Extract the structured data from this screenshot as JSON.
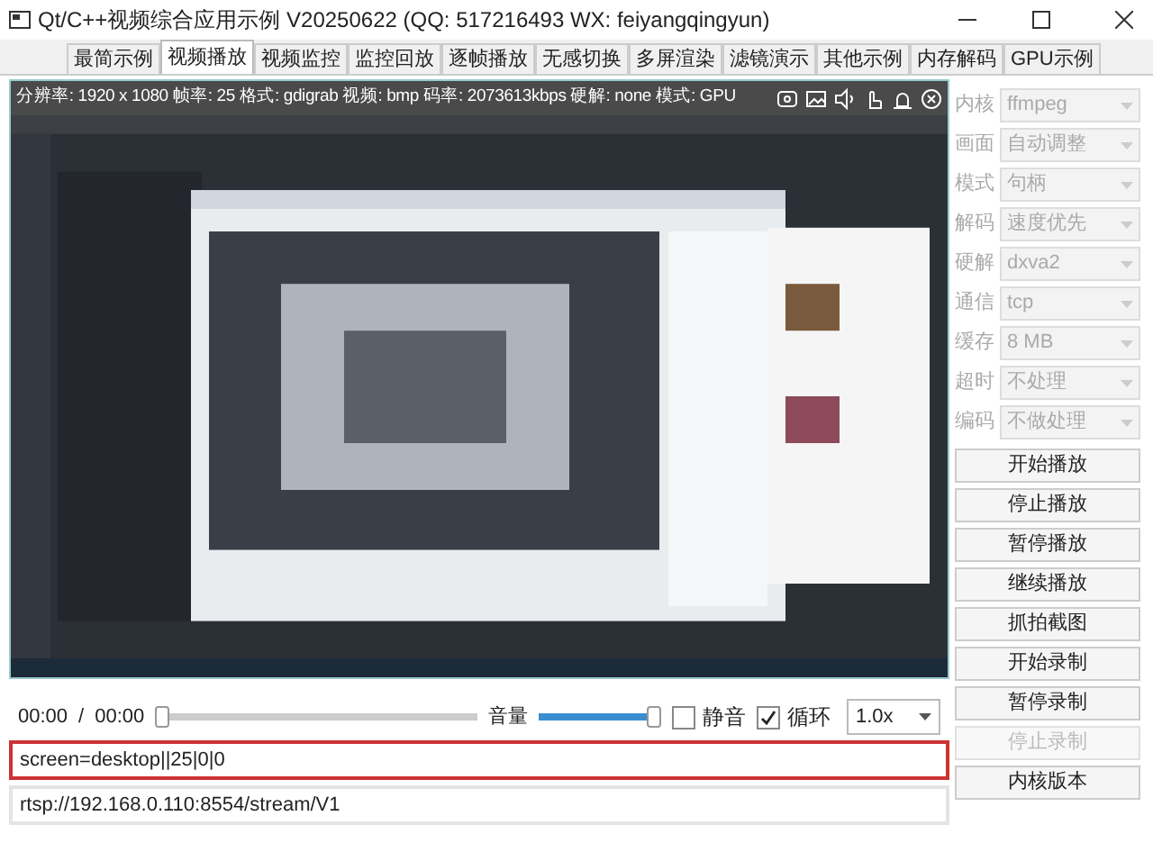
{
  "window": {
    "title": "Qt/C++视频综合应用示例 V20250622 (QQ: 517216493 WX: feiyangqingyun)"
  },
  "tabs": [
    {
      "label": "最简示例",
      "selected": false
    },
    {
      "label": "视频播放",
      "selected": true
    },
    {
      "label": "视频监控",
      "selected": false
    },
    {
      "label": "监控回放",
      "selected": false
    },
    {
      "label": "逐帧播放",
      "selected": false
    },
    {
      "label": "无感切换",
      "selected": false
    },
    {
      "label": "多屏渲染",
      "selected": false
    },
    {
      "label": "滤镜演示",
      "selected": false
    },
    {
      "label": "其他示例",
      "selected": false
    },
    {
      "label": "内存解码",
      "selected": false
    },
    {
      "label": "GPU示例",
      "selected": false
    }
  ],
  "info_bar": {
    "text": "分辨率: 1920 x 1080  帧率: 25  格式: gdigrab  视频: bmp  码率: 2073613kbps  硬解: none  模式: GPU"
  },
  "controls": {
    "position": "00:00",
    "separator": "/",
    "duration": "00:00",
    "progress": {
      "level": 0
    },
    "volume_label": "音量",
    "volume": {
      "level": 1
    },
    "mute": {
      "label": "静音",
      "checked": false
    },
    "loop": {
      "label": "循环",
      "checked": true
    },
    "speed": "1.0x"
  },
  "url_fields": [
    {
      "value": "screen=desktop||25|0|0",
      "highlighted": true
    },
    {
      "value": "rtsp://192.168.0.110:8554/stream/V1",
      "highlighted": false
    }
  ],
  "settings": [
    {
      "label": "内核",
      "value": "ffmpeg",
      "disabled": true
    },
    {
      "label": "画面",
      "value": "自动调整",
      "disabled": true
    },
    {
      "label": "模式",
      "value": "句柄",
      "disabled": true
    },
    {
      "label": "解码",
      "value": "速度优先",
      "disabled": true
    },
    {
      "label": "硬解",
      "value": "dxva2",
      "disabled": true
    },
    {
      "label": "通信",
      "value": "tcp",
      "disabled": true
    },
    {
      "label": "缓存",
      "value": "8 MB",
      "disabled": true
    },
    {
      "label": "超时",
      "value": "不处理",
      "disabled": true
    },
    {
      "label": "编码",
      "value": "不做处理",
      "disabled": true
    }
  ],
  "buttons": [
    {
      "label": "开始播放",
      "disabled": false
    },
    {
      "label": "停止播放",
      "disabled": false
    },
    {
      "label": "暂停播放",
      "disabled": false
    },
    {
      "label": "继续播放",
      "disabled": false
    },
    {
      "label": "抓拍截图",
      "disabled": false
    },
    {
      "label": "开始录制",
      "disabled": false
    },
    {
      "label": "暂停录制",
      "disabled": false
    },
    {
      "label": "停止录制",
      "disabled": true
    },
    {
      "label": "内核版本",
      "disabled": false
    }
  ]
}
